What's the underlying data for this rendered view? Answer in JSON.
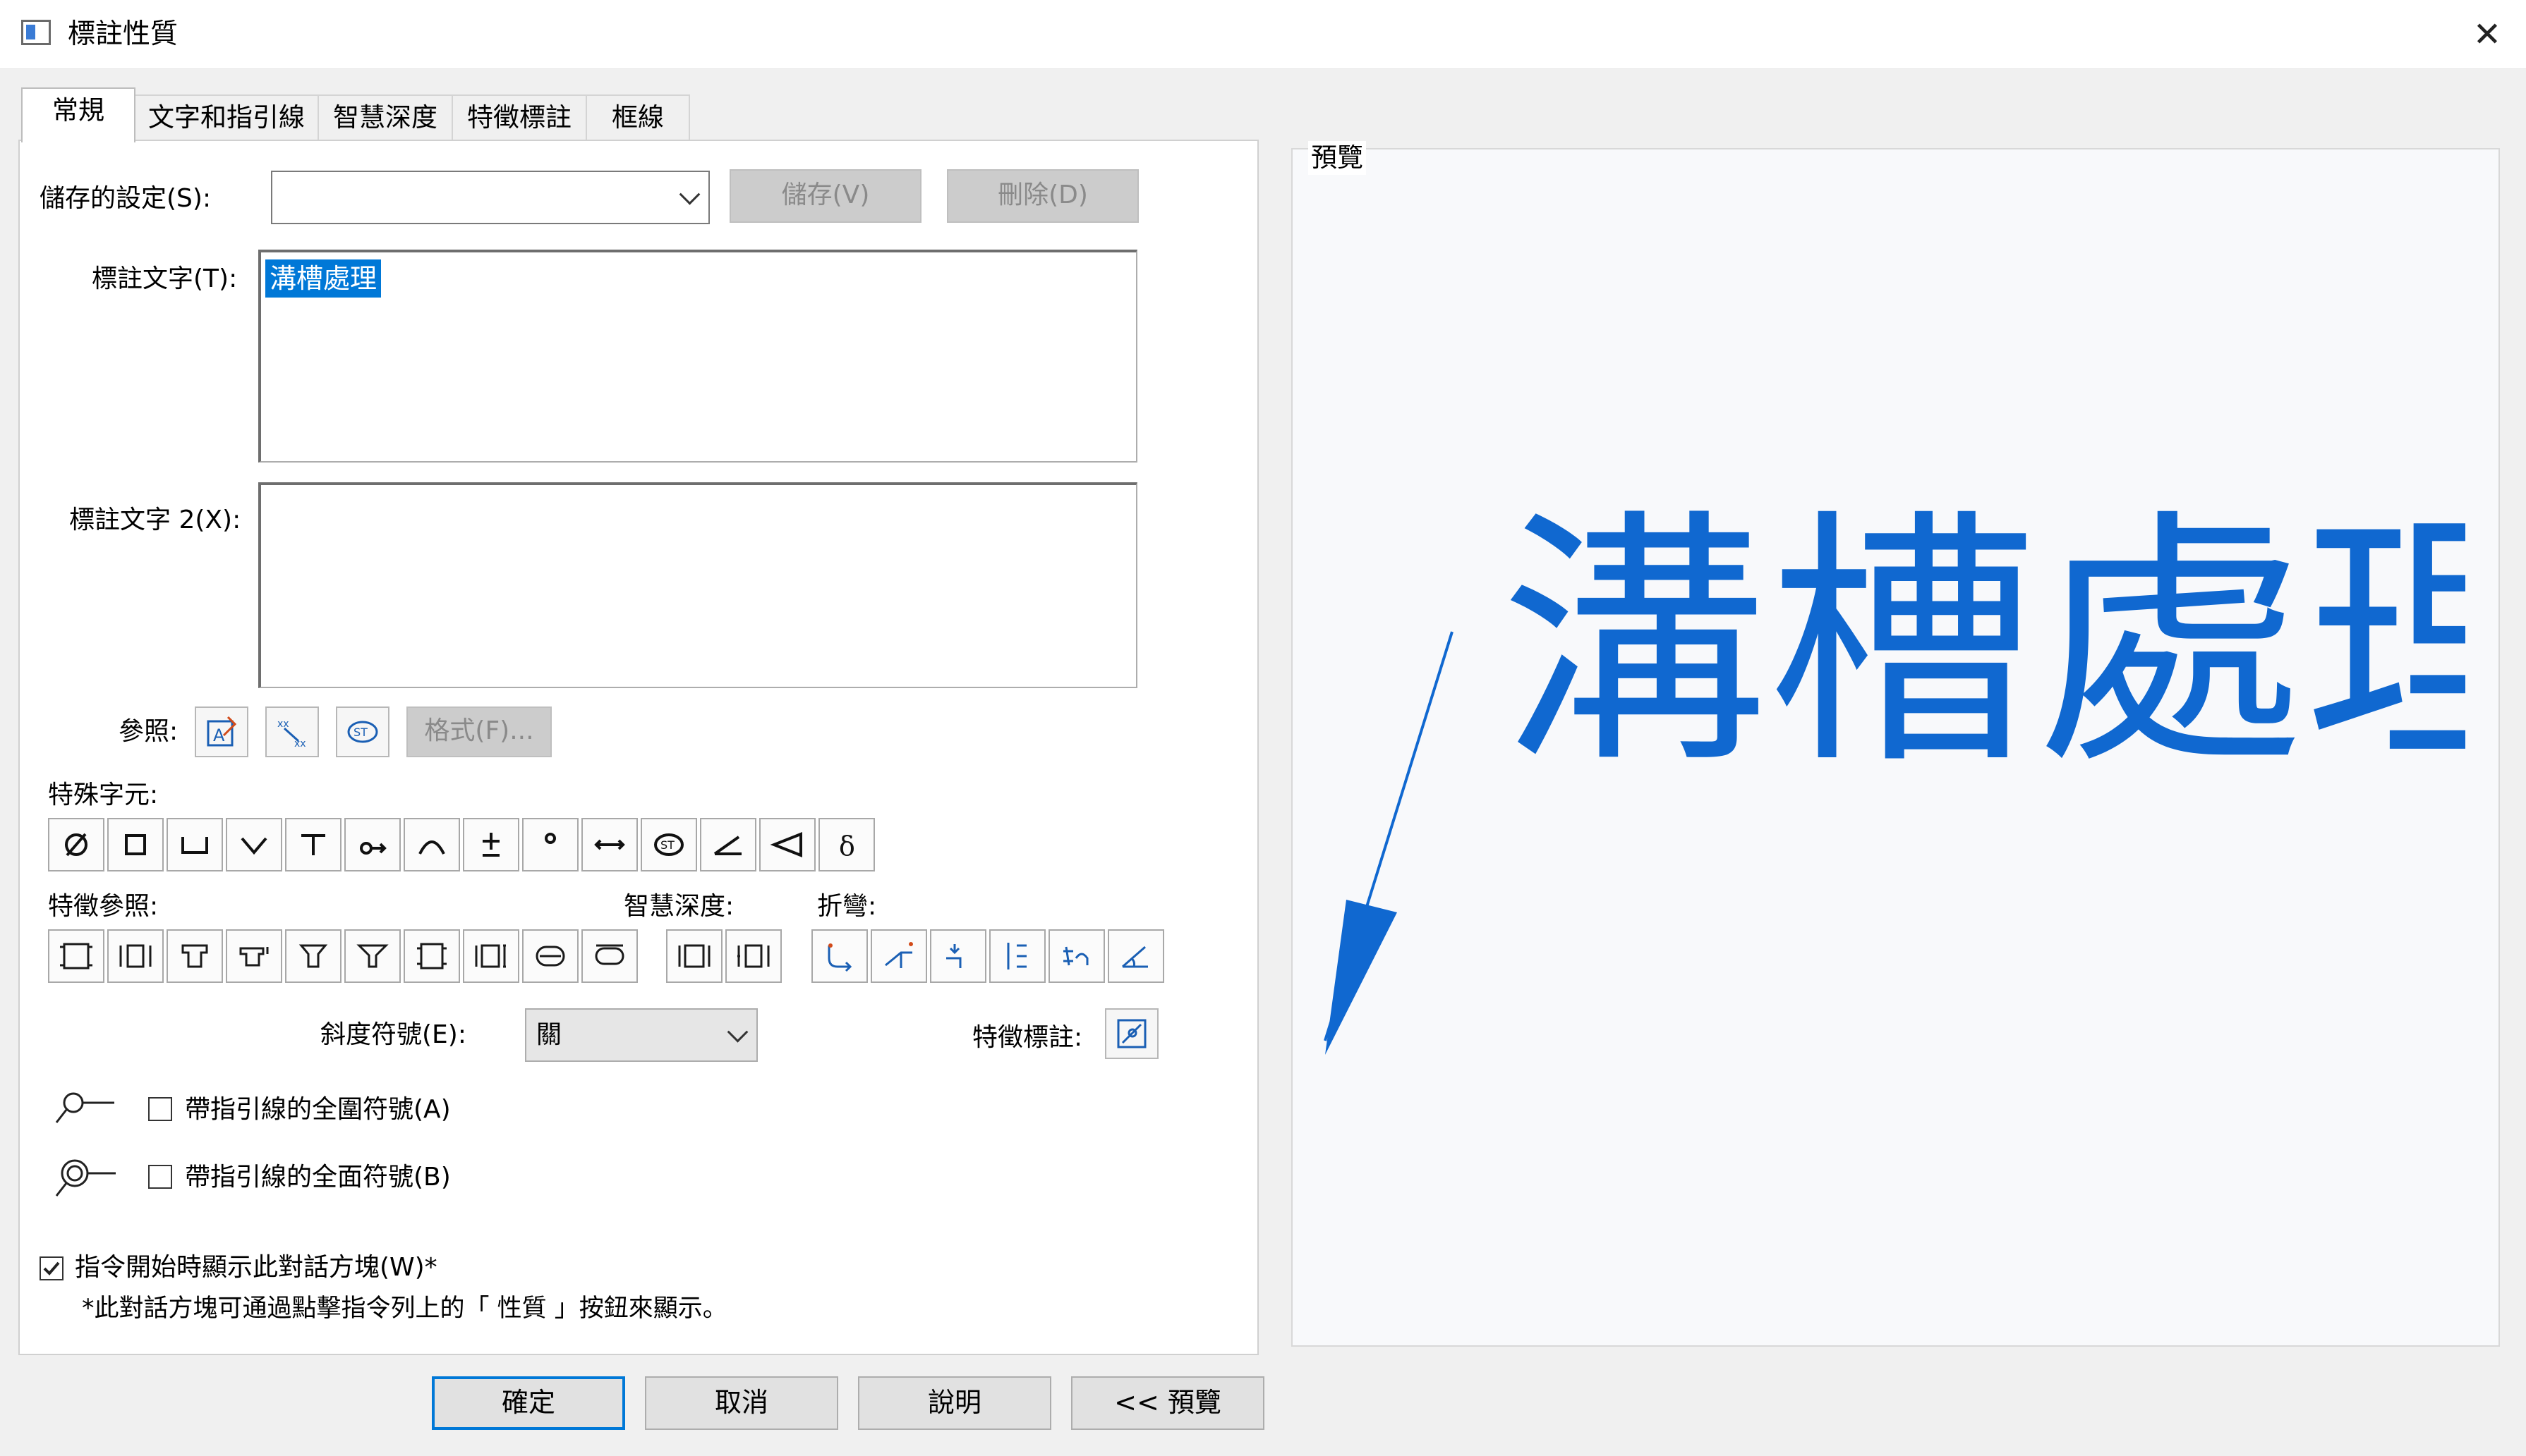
{
  "window": {
    "title": "標註性質",
    "close_label": "✕"
  },
  "tabs": [
    {
      "label": "常規"
    },
    {
      "label": "文字和指引線"
    },
    {
      "label": "智慧深度"
    },
    {
      "label": "特徵標註"
    },
    {
      "label": "框線"
    }
  ],
  "saved_settings": {
    "label": "儲存的設定(S):",
    "value": "",
    "save_button": "儲存(V)",
    "delete_button": "刪除(D)"
  },
  "callout_text": {
    "label": "標註文字(T):",
    "value": "溝槽處理"
  },
  "callout_text2": {
    "label": "標註文字 2(X):",
    "value": ""
  },
  "reference": {
    "label": "參照:",
    "format_button": "格式(F)..."
  },
  "special_chars": {
    "label": "特殊字元:"
  },
  "feature_reference": {
    "label": "特徵參照:"
  },
  "smart_depth": {
    "label": "智慧深度:"
  },
  "bend": {
    "label": "折彎:"
  },
  "bevel": {
    "label": "斜度符號(E):",
    "value": "關"
  },
  "feature_callout": {
    "label": "特徵標註:"
  },
  "options": {
    "all_around_leader": "帶指引線的全圍符號(A)",
    "all_over_leader": "帶指引線的全面符號(B)",
    "show_on_start": "指令開始時顯示此對話方塊(W)*",
    "note": "*此對話方塊可通過點擊指令列上的「 性質 」按鈕來顯示。"
  },
  "preview": {
    "label": "預覽",
    "text": "溝槽處理",
    "color": "#1068d0"
  },
  "buttons": {
    "ok": "確定",
    "cancel": "取消",
    "help": "說明",
    "preview": "<< 預覽"
  },
  "colors": {
    "accent": "#0078d7",
    "icon_blue": "#1a5fb4"
  }
}
